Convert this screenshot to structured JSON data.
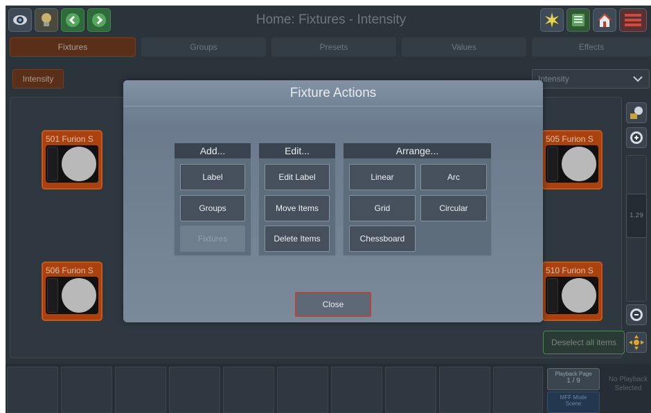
{
  "header": {
    "title": "Home: Fixtures - Intensity",
    "left_icons": [
      "eye-icon",
      "lightbulb-icon",
      "chevron-left-icon",
      "chevron-right-icon"
    ],
    "right_icons": [
      "star-burst-icon",
      "sheet-icon",
      "home-icon",
      "menu-icon"
    ]
  },
  "tabs": [
    {
      "label": "Fixtures",
      "active": true
    },
    {
      "label": "Groups",
      "active": false
    },
    {
      "label": "Presets",
      "active": false
    },
    {
      "label": "Values",
      "active": false
    },
    {
      "label": "Effects",
      "active": false
    }
  ],
  "toolbar": {
    "intensity_button": "Intensity",
    "dropdown_value": "Intensity"
  },
  "fixtures": [
    {
      "label": "501 Furion S"
    },
    {
      "label": "505 Furion S"
    },
    {
      "label": "506 Furion S"
    },
    {
      "label": "510 Furion S"
    }
  ],
  "side": {
    "zoom_value": "1.29",
    "deselect_label": "Deselect all items"
  },
  "playback": {
    "page_label": "Playback Page",
    "page_value": "1 / 9",
    "mff_label": "MFF Mode",
    "mff_value": "Scene",
    "no_playback": "No Playback Selected"
  },
  "modal": {
    "title": "Fixture Actions",
    "add": {
      "heading": "Add...",
      "items": [
        "Label",
        "Groups",
        "Fixtures"
      ]
    },
    "edit": {
      "heading": "Edit...",
      "items": [
        "Edit Label",
        "Move Items",
        "Delete Items"
      ]
    },
    "arrange": {
      "heading": "Arrange...",
      "items": [
        "Linear",
        "Arc",
        "Grid",
        "Circular",
        "Chessboard"
      ]
    },
    "close_label": "Close"
  },
  "colors": {
    "accent_orange": "#a9420f",
    "active_tab": "#5a2f1a",
    "modal_bg": "#7a8a9a",
    "close_border": "#b0473a",
    "deselect_border": "#4c8a52"
  }
}
